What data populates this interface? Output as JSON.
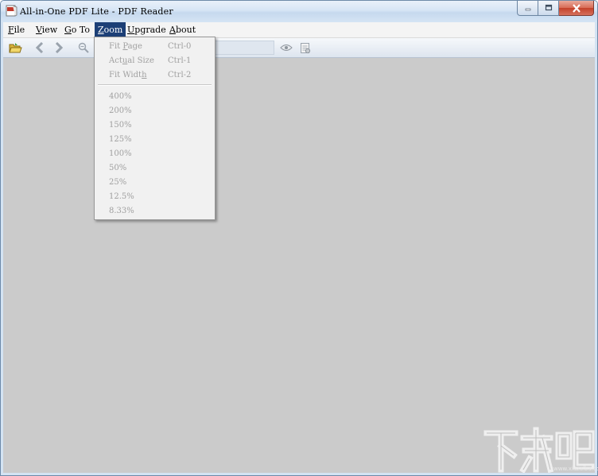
{
  "window": {
    "title": "All-in-One PDF Lite - PDF Reader",
    "icons": {
      "app": "pdf-app-icon",
      "minimize": "minimize-icon",
      "maximize": "maximize-icon",
      "close": "close-icon"
    }
  },
  "menubar": {
    "items": [
      {
        "pre": "",
        "accel": "F",
        "post": "ile"
      },
      {
        "pre": "",
        "accel": "V",
        "post": "iew"
      },
      {
        "pre": "",
        "accel": "G",
        "post": "o To"
      },
      {
        "pre": "",
        "accel": "Z",
        "post": "oom"
      },
      {
        "pre": "",
        "accel": "U",
        "post": "pgrade"
      },
      {
        "pre": "",
        "accel": "A",
        "post": "bout"
      }
    ],
    "active": "Zoom"
  },
  "toolbar": {
    "icons": [
      "open-folder-icon",
      "back-arrow-icon",
      "forward-arrow-icon",
      "zoom-out-icon",
      "view-icon",
      "properties-icon"
    ]
  },
  "zoom_menu": {
    "fit_items": [
      {
        "pre": "Fit ",
        "accel": "P",
        "post": "age",
        "shortcut": "Ctrl-0"
      },
      {
        "pre": "Act",
        "accel": "u",
        "post": "al Size",
        "shortcut": "Ctrl-1"
      },
      {
        "pre": "Fit Widt",
        "accel": "h",
        "post": "",
        "shortcut": "Ctrl-2"
      }
    ],
    "levels": [
      "400%",
      "200%",
      "150%",
      "125%",
      "100%",
      "50%",
      "25%",
      "12.5%",
      "8.33%"
    ],
    "enabled": false
  },
  "watermark": {
    "text": "下载吧",
    "url": "www.xiazaiba.com"
  }
}
